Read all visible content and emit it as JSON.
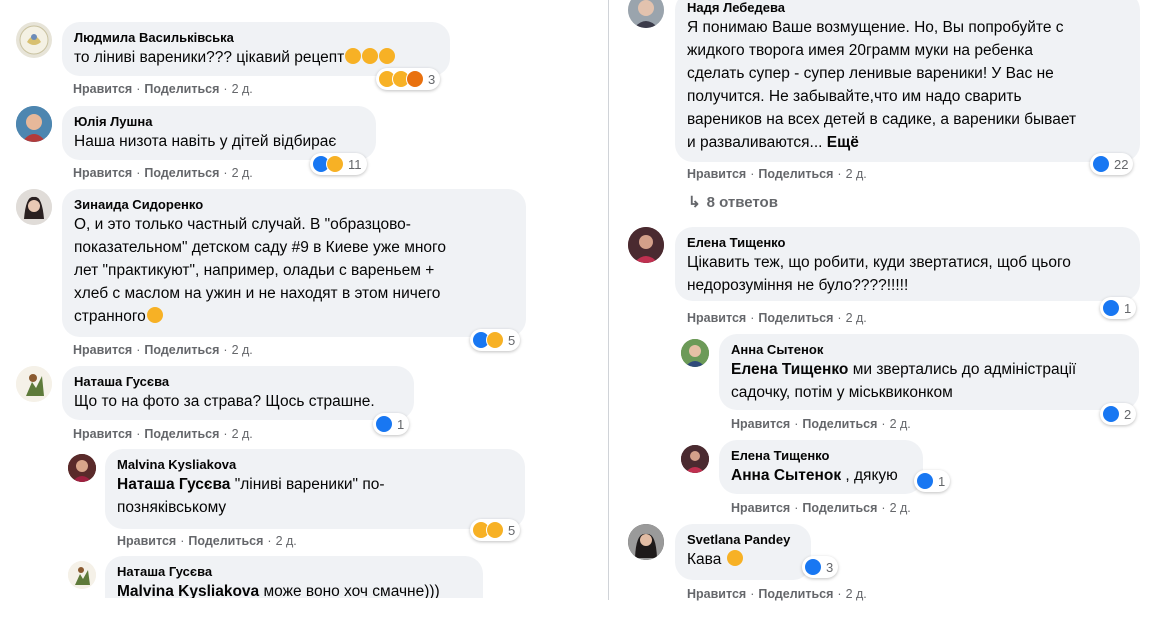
{
  "actions": {
    "like": "Нравится",
    "reply": "Поделиться"
  },
  "colors": {
    "like": "#1877f2",
    "emoji": "#f7b125",
    "angry": "#e9710f",
    "bubble": "#f0f2f5",
    "meta": "#65676b"
  },
  "left": [
    {
      "author": "Людмила Васильківська",
      "text": "то ліниві вареники??? цікавий рецепт",
      "time": "2 д.",
      "reactions": [
        "haha",
        "wow",
        "angry"
      ],
      "count": "3"
    },
    {
      "author": "Юлія Лушна",
      "text": "Наша низота навіть у дітей відбирає",
      "time": "2 д.",
      "reactions": [
        "like",
        "sad"
      ],
      "count": "11"
    },
    {
      "author": "Зинаида Сидоренко",
      "lines": [
        "О, и это только частный случай. В \"образцово-",
        "показательном\" детском саду #9 в Киеве уже много",
        "лет \"практикуют\", например, оладьи с вареньем +",
        "хлеб с маслом на ужин и не находят в этом ничего",
        "странного"
      ],
      "time": "2 д.",
      "reactions": [
        "like",
        "wow"
      ],
      "count": "5"
    },
    {
      "author": "Наташа Гусєва",
      "text": "Що то на фото за страва? Щось страшне.",
      "time": "2 д.",
      "reactions": [
        "like"
      ],
      "count": "1"
    },
    {
      "author": "Malvina Kysliakova",
      "mention": "Наташа Гусєва",
      "lines": [
        "\"ліниві вареники\" по-",
        "позняківському"
      ],
      "time": "2 д.",
      "reactions": [
        "sad",
        "wow"
      ],
      "count": "5"
    },
    {
      "author": "Наташа Гусєва",
      "mention": "Malvina Kysliakova",
      "text": "може воно хоч смачне)))"
    }
  ],
  "right": [
    {
      "author": "Надя Лебедева",
      "lines": [
        "Я понимаю Ваше возмущение. Но, Вы попробуйте с",
        "жидкого творога имея 20грамм муки на ребенка",
        "сделать супер - супер ленивые вареники! У Вас не",
        "получится. Не забывайте,что им надо сварить",
        "вареников на всех детей в садике, а вареники бывает",
        "и разваливаются..."
      ],
      "more": "Ещё",
      "time": "2 д.",
      "reactions": [
        "like"
      ],
      "count": "22"
    },
    {
      "replies": "8 ответов"
    },
    {
      "author": "Елена Тищенко",
      "lines": [
        "Цікавить теж, що робити, куди звертатися, щоб цього",
        "недорозуміння не було????!!!!!"
      ],
      "time": "2 д.",
      "reactions": [
        "like"
      ],
      "count": "1"
    },
    {
      "author": "Анна Сытенок",
      "mention": "Елена Тищенко",
      "lines": [
        "ми звертались до адміністрації",
        "садочку, потім у міськвиконком"
      ],
      "time": "2 д.",
      "reactions": [
        "like"
      ],
      "count": "2"
    },
    {
      "author": "Елена Тищенко",
      "mention": "Анна Сытенок",
      "text": ", дякую",
      "time": "2 д.",
      "reactions": [
        "like"
      ],
      "count": "1"
    },
    {
      "author": "Svetlana Pandey",
      "text": "Кава",
      "time": "2 д.",
      "reactions": [
        "like"
      ],
      "count": "3"
    }
  ]
}
